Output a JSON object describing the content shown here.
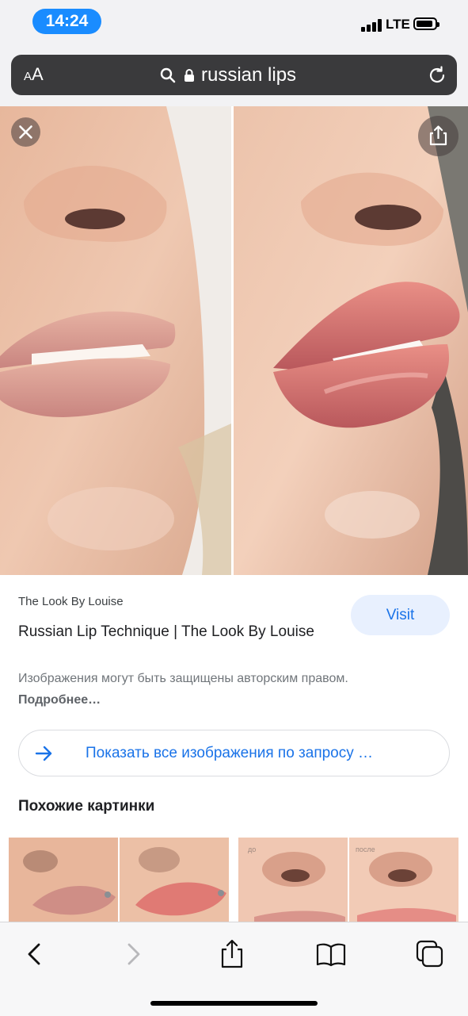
{
  "status": {
    "time": "14:24",
    "network": "LTE"
  },
  "browser": {
    "text_size_label": "AA",
    "url": "russian lips"
  },
  "result": {
    "source": "The Look By Louise",
    "title": "Russian Lip Technique | The Look By Louise",
    "visit_label": "Visit",
    "copyright_text": "Изображения могут быть защищены авторским правом.",
    "more_link": "Подробнее…",
    "show_all_label": "Показать все изображения по запросу …"
  },
  "similar": {
    "heading": "Похожие картинки",
    "thumb2_before_label": "до",
    "thumb2_after_label": "после"
  },
  "toolbar": {
    "icons": [
      "back-icon",
      "forward-icon",
      "share-icon",
      "bookmarks-icon",
      "tabs-icon"
    ]
  },
  "colors": {
    "accent": "#1a73e8",
    "time_pill": "#1a8cff",
    "address_bar": "#3a3a3c"
  }
}
